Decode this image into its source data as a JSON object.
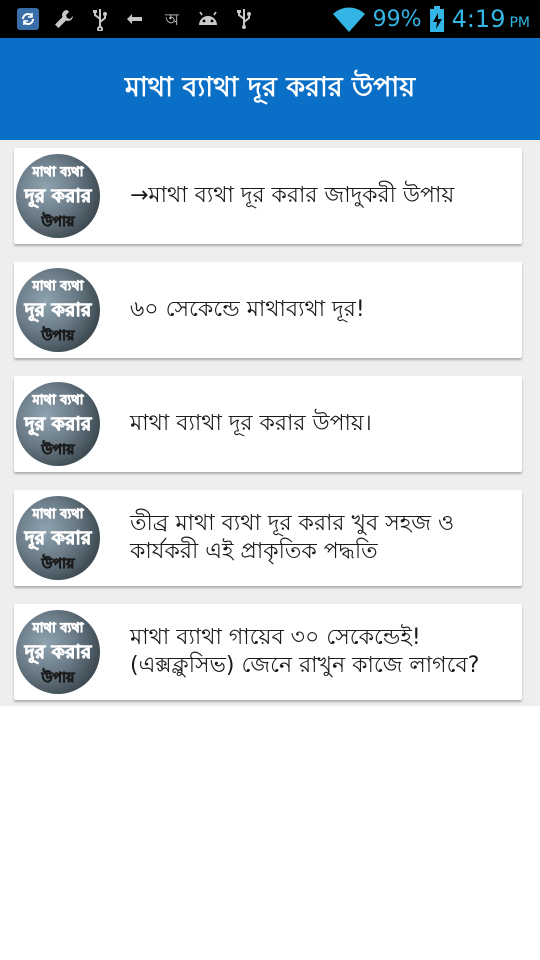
{
  "status_bar": {
    "battery": "99%",
    "time": "4:19",
    "ampm": "PM",
    "left_icons": [
      "recycle-icon",
      "wrench-icon",
      "usb-icon",
      "arrow-swap-icon",
      "bangla-keyboard-icon",
      "android-icon",
      "usb-icon"
    ],
    "accent_color": "#33b5e5"
  },
  "app_bar": {
    "title": "মাথা ব্যাথা দূর করার উপায়",
    "color": "#0a6fc7"
  },
  "list": {
    "items": [
      {
        "title": "→মাথা ব্যথা দূর করার জাদুকরী উপায়",
        "thumb_caption": [
          "মাথা ব্যথা",
          "দূর করার",
          "উপায়"
        ]
      },
      {
        "title": "৬০ সেকেন্ডে মাথাব্যথা দূর!",
        "thumb_caption": [
          "মাথা ব্যথা",
          "দূর করার",
          "উপায়"
        ]
      },
      {
        "title": "মাথা ব্যাথা দূর করার উপায়।",
        "thumb_caption": [
          "মাথা ব্যথা",
          "দূর করার",
          "উপায়"
        ]
      },
      {
        "title": "তীব্র মাথা ব্যথা দূর করার খুব সহজ ও কার্যকরী এই প্রাকৃতিক পদ্ধতি",
        "thumb_caption": [
          "মাথা ব্যথা",
          "দূর করার",
          "উপায়"
        ]
      },
      {
        "title": "মাথা ব্যাথা গায়েব ৩০ সেকেন্ডেই!(এক্সক্লুসিভ) জেনে রাখুন কাজে লাগবে?",
        "thumb_caption": [
          "মাথা ব্যথা",
          "দূর করার",
          "উপায়"
        ]
      }
    ]
  }
}
